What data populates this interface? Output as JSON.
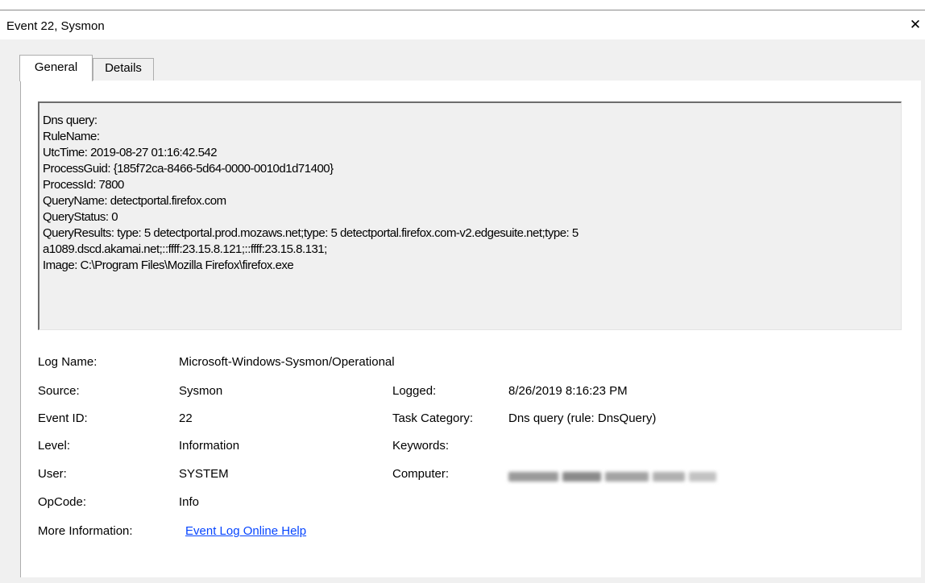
{
  "window": {
    "title": "Event 22, Sysmon",
    "close_glyph": "✕"
  },
  "tabs": [
    {
      "label": "General",
      "active": true
    },
    {
      "label": "Details",
      "active": false
    }
  ],
  "description_lines": [
    "Dns query:",
    "RuleName:",
    "UtcTime: 2019-08-27 01:16:42.542",
    "ProcessGuid: {185f72ca-8466-5d64-0000-0010d1d71400}",
    "ProcessId: 7800",
    "QueryName: detectportal.firefox.com",
    "QueryStatus: 0",
    "QueryResults: type:  5 detectportal.prod.mozaws.net;type:  5 detectportal.firefox.com-v2.edgesuite.net;type:  5",
    "a1089.dscd.akamai.net;::ffff:23.15.8.121;::ffff:23.15.8.131;",
    "Image: C:\\Program Files\\Mozilla Firefox\\firefox.exe"
  ],
  "fields": {
    "log_name": {
      "label": "Log Name:",
      "value": "Microsoft-Windows-Sysmon/Operational"
    },
    "source": {
      "label": "Source:",
      "value": "Sysmon"
    },
    "logged": {
      "label": "Logged:",
      "value": "8/26/2019 8:16:23 PM"
    },
    "event_id": {
      "label": "Event ID:",
      "value": "22"
    },
    "task_category": {
      "label": "Task Category:",
      "value": "Dns query (rule: DnsQuery)"
    },
    "level": {
      "label": "Level:",
      "value": "Information"
    },
    "keywords": {
      "label": "Keywords:",
      "value": ""
    },
    "user": {
      "label": "User:",
      "value": "SYSTEM"
    },
    "computer": {
      "label": "Computer:",
      "value_redacted": true
    },
    "opcode": {
      "label": "OpCode:",
      "value": "Info"
    },
    "more_information": {
      "label": "More Information:",
      "link_text": "Event Log Online Help"
    }
  },
  "colors": {
    "dialog_background": "#f0f0f0",
    "link": "#0645ff",
    "description_background": "#f0f0f0"
  }
}
